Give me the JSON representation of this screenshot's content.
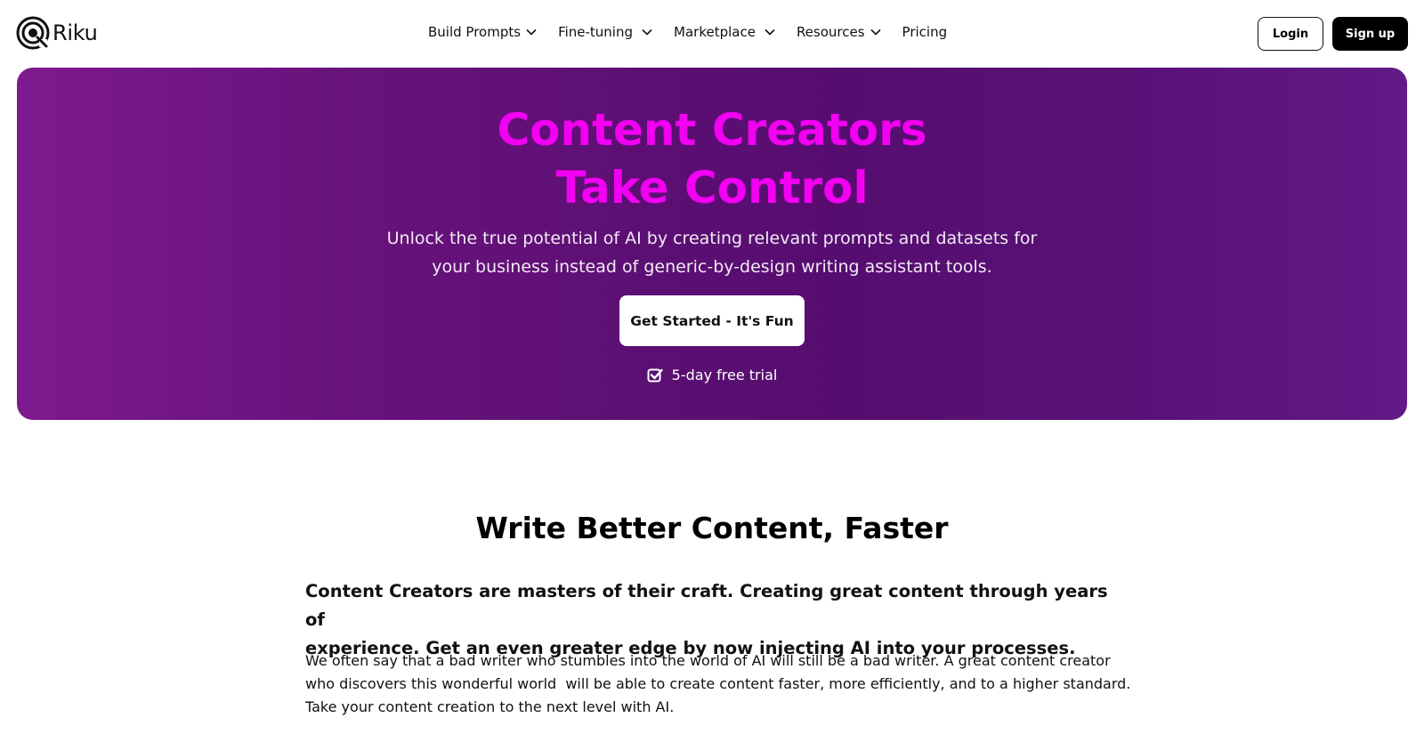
{
  "brand": {
    "name": "Riku",
    "logo_icon": "riku-logo-icon"
  },
  "nav": {
    "items": [
      {
        "label": "Build Prompts",
        "has_dropdown": true
      },
      {
        "label": "Fine-tuning",
        "has_dropdown": true
      },
      {
        "label": "Marketplace",
        "has_dropdown": true
      },
      {
        "label": "Resources",
        "has_dropdown": true
      },
      {
        "label": "Pricing",
        "has_dropdown": false
      }
    ],
    "login_label": "Login",
    "signup_label": "Sign up"
  },
  "hero": {
    "title_line1": "Content Creators",
    "title_line2": "Take Control",
    "subtitle_line1": "Unlock the true potential of AI by creating relevant prompts and datasets for",
    "subtitle_line2": "your business instead of generic-by-design writing assistant tools.",
    "cta_label": "Get Started - It's Fun",
    "trial_label": "5-day free trial",
    "title_color": "#f200f2",
    "bg_color": "#5c0f73"
  },
  "section": {
    "title": "Write Better Content, Faster",
    "lead_line1": "Content Creators are masters of their craft. Creating great content through years of",
    "lead_line2": "experience. Get an even greater edge by now injecting AI into your processes.",
    "body_line1": "We often say that a bad writer who stumbles into the world of AI will still be a bad writer. A great content creator",
    "body_line2": "who discovers this wonderful world  will be able to create content faster, more efficiently, and to a higher standard.",
    "body_line3": "Take your content creation to the next level with AI."
  }
}
